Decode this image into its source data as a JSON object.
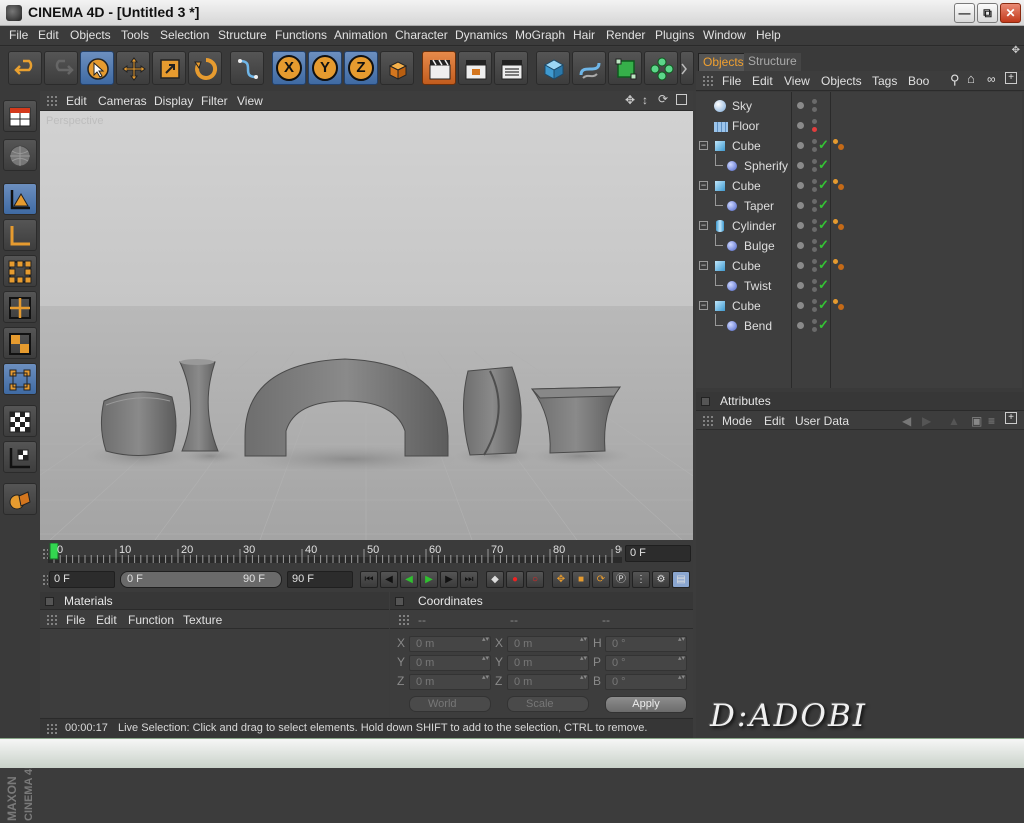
{
  "window": {
    "title": "CINEMA 4D - [Untitled 3 *]",
    "minimize_icon": "minimize-icon",
    "maximize_icon": "restore-icon",
    "close_icon": "close-icon"
  },
  "menubar": [
    "File",
    "Edit",
    "Objects",
    "Tools",
    "Selection",
    "Structure",
    "Functions",
    "Animation",
    "Character",
    "Dynamics",
    "MoGraph",
    "Hair",
    "Render",
    "Plugins",
    "Window",
    "Help"
  ],
  "toolbar": {
    "icons": [
      "undo-icon",
      "redo-icon",
      "live-selection-icon",
      "move-icon",
      "scale-icon",
      "rotate-icon",
      "spline-icon",
      "x-axis-lock-icon",
      "y-axis-lock-icon",
      "z-axis-lock-icon",
      "coordinate-system-icon",
      "render-view-icon",
      "render-picture-viewer-icon",
      "render-settings-icon",
      "cube-primitive-icon",
      "spline-pen-icon",
      "nurbs-icon",
      "array-icon",
      "deformer-icon"
    ],
    "axes": {
      "x": "X",
      "y": "Y",
      "z": "Z"
    }
  },
  "viewport": {
    "menu": [
      "Edit",
      "Cameras",
      "Display",
      "Filter",
      "View"
    ],
    "label": "Perspective",
    "nav_icons": [
      "move-view-icon",
      "scroll-view-icon",
      "rotate-view-icon",
      "maximize-view-icon"
    ]
  },
  "timeline": {
    "ticks": [
      "0",
      "10",
      "20",
      "30",
      "40",
      "50",
      "60",
      "70",
      "80",
      "90"
    ],
    "current_frame": "0 F",
    "start_frame": "0 F",
    "range_start": "0 F",
    "range_end": "90 F",
    "end_frame": "90 F"
  },
  "playback_icons": [
    "go-to-start-icon",
    "previous-key-icon",
    "play-backwards-icon",
    "play-forwards-icon",
    "next-key-icon",
    "go-to-end-icon",
    "record-icon",
    "autokey-icon",
    "keyframe-selection-icon",
    "position-key-icon",
    "scale-key-icon",
    "rotation-key-icon",
    "parameter-key-icon",
    "point-level-icon",
    "playback-settings-icon"
  ],
  "materials": {
    "title": "Materials",
    "menu": [
      "File",
      "Edit",
      "Function",
      "Texture"
    ]
  },
  "coordinates": {
    "title": "Coordinates",
    "columns": [
      "--",
      "--",
      "--"
    ],
    "rows": [
      {
        "l1": "X",
        "v1": "0 m",
        "l2": "X",
        "v2": "0 m",
        "l3": "H",
        "v3": "0 °"
      },
      {
        "l1": "Y",
        "v1": "0 m",
        "l2": "Y",
        "v2": "0 m",
        "l3": "P",
        "v3": "0 °"
      },
      {
        "l1": "Z",
        "v1": "0 m",
        "l2": "Z",
        "v2": "0 m",
        "l3": "B",
        "v3": "0 °"
      }
    ],
    "mode": "World",
    "size_mode": "Scale",
    "apply": "Apply"
  },
  "status": {
    "time": "00:00:17",
    "message": "Live Selection: Click and drag to select elements. Hold down SHIFT to add to the selection, CTRL to remove."
  },
  "objects_panel": {
    "tabs": [
      "Objects",
      "Structure"
    ],
    "menu": [
      "File",
      "Edit",
      "View",
      "Objects",
      "Tags",
      "Boo"
    ],
    "items": [
      {
        "name": "Sky",
        "icon": "sky-icon",
        "depth": 0
      },
      {
        "name": "Floor",
        "icon": "floor-icon",
        "depth": 0
      },
      {
        "name": "Cube",
        "icon": "cube-icon",
        "depth": 0
      },
      {
        "name": "Spherify",
        "icon": "spherify-icon",
        "depth": 1
      },
      {
        "name": "Cube",
        "icon": "cube-icon",
        "depth": 0
      },
      {
        "name": "Taper",
        "icon": "taper-icon",
        "depth": 1
      },
      {
        "name": "Cylinder",
        "icon": "cylinder-icon",
        "depth": 0
      },
      {
        "name": "Bulge",
        "icon": "bulge-icon",
        "depth": 1
      },
      {
        "name": "Cube",
        "icon": "cube-icon",
        "depth": 0
      },
      {
        "name": "Twist",
        "icon": "twist-icon",
        "depth": 1
      },
      {
        "name": "Cube",
        "icon": "cube-icon",
        "depth": 0
      },
      {
        "name": "Bend",
        "icon": "bend-icon",
        "depth": 1
      }
    ]
  },
  "attributes_panel": {
    "title": "Attributes",
    "menu": [
      "Mode",
      "Edit",
      "User Data"
    ]
  },
  "brand": {
    "maxon": "MAXON",
    "product": "CINEMA 4D"
  },
  "watermark": "D:ADOBI",
  "colors": {
    "accent_orange": "#e69b2f",
    "highlight_blue": "#4f78ad",
    "panel_bg": "#3c3c3c",
    "check_green": "#35c235"
  }
}
